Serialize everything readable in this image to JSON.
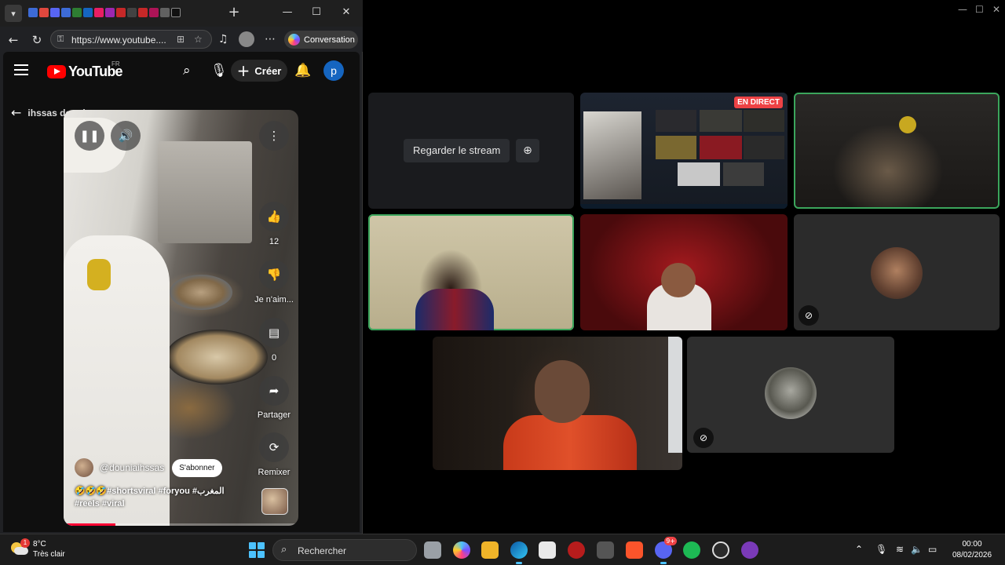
{
  "browser": {
    "address": "https://www.youtube....",
    "copilot_label": "Conversation"
  },
  "youtube": {
    "logo_text": "YouTube",
    "region": "FR",
    "create_label": "Créer",
    "avatar_letter": "p",
    "back_channel": "ihssas dounia",
    "short": {
      "likes": "12",
      "dislike_label": "Je n'aim...",
      "comments": "0",
      "share_label": "Partager",
      "remix_label": "Remixer",
      "handle": "@douniaihssas",
      "subscribe_label": "S'abonner",
      "caption": "🤣🤣🤣#shortsviral #foryou #المغرب #reels #viral",
      "progress_fraction": 0.22
    }
  },
  "call": {
    "live_badge": "EN DIRECT",
    "watch_stream_label": "Regarder le stream"
  },
  "taskbar": {
    "weather_temp": "8°C",
    "weather_desc": "Très clair",
    "weather_badge": "1",
    "search_placeholder": "Rechercher",
    "discord_badge": "9+",
    "time": "00:00",
    "date": "08/02/2026"
  },
  "colors": {
    "youtube_red": "#ff0000",
    "speaking_green": "#3ba55c",
    "live_red": "#ed4245",
    "accent_blue": "#4cc2ff"
  }
}
